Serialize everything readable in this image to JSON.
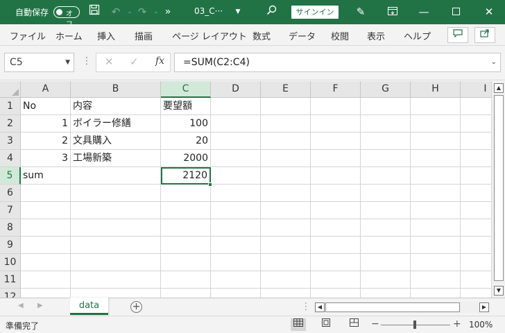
{
  "titlebar": {
    "autosave_label": "自動保存",
    "autosave_state": "オフ",
    "filename": "03_C···",
    "signin_label": "サインイン",
    "icons": [
      "save-icon",
      "undo-icon",
      "redo-icon",
      "more-icon",
      "search-icon",
      "pen-icon",
      "ribbon-display-icon",
      "minimize-icon",
      "maximize-icon",
      "close-icon"
    ]
  },
  "menu": {
    "items": [
      "ファイル",
      "ホーム",
      "挿入",
      "描画",
      "ページ レイアウト",
      "数式",
      "データ",
      "校閲",
      "表示",
      "ヘルプ"
    ]
  },
  "formula_bar": {
    "name_box": "C5",
    "formula": "=SUM(C2:C4)",
    "fx": "fx"
  },
  "grid": {
    "columns": [
      "A",
      "B",
      "C",
      "D",
      "E",
      "F",
      "G",
      "H",
      "I"
    ],
    "rows": [
      "1",
      "2",
      "3",
      "4",
      "5",
      "6",
      "7",
      "8",
      "9",
      "10",
      "11",
      "12"
    ],
    "selected_column": "C",
    "selected_row": "5",
    "active_cell": "C5",
    "data": [
      [
        "No",
        "内容",
        "要望額"
      ],
      [
        "1",
        "ボイラー修繕",
        "100"
      ],
      [
        "2",
        "文具購入",
        "20"
      ],
      [
        "3",
        "工場新築",
        "2000"
      ],
      [
        "sum",
        "",
        "2120"
      ]
    ]
  },
  "sheets": {
    "tabs": [
      "data"
    ],
    "active": "data"
  },
  "status": {
    "text": "準備完了",
    "zoom_minus": "−",
    "zoom_plus": "+",
    "zoom": "100%"
  },
  "colors": {
    "accent": "#217346",
    "selected_header": "#d2e9da"
  }
}
